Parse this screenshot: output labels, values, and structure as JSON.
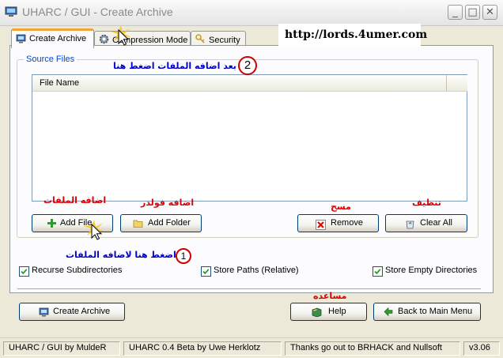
{
  "window": {
    "title": "UHARC / GUI - Create Archive",
    "controls": {
      "minimize": "_",
      "maximize": "□",
      "close": "✕"
    }
  },
  "tabs": [
    {
      "label": "Create Archive",
      "active": true,
      "icon": "create-archive-icon"
    },
    {
      "label": "Compression Mode",
      "active": false,
      "icon": "gear-icon"
    },
    {
      "label": "Security",
      "active": false,
      "icon": "keys-icon"
    }
  ],
  "watermark_url": "http://lords.4umer.com",
  "source_files": {
    "label": "Source Files",
    "column_header": "File Name",
    "items": []
  },
  "buttons": {
    "add_file": "Add File",
    "add_folder": "Add Folder",
    "remove": "Remove",
    "clear_all": "Clear All",
    "create_archive": "Create Archive",
    "help": "Help",
    "back": "Back to Main Menu"
  },
  "options": [
    {
      "label": "Recurse Subdirectories",
      "checked": true
    },
    {
      "label": "Store Paths (Relative)",
      "checked": true
    },
    {
      "label": "Store Empty Directories",
      "checked": true
    }
  ],
  "annotations": {
    "step1_number": "1",
    "step1_text": "اضغط هنا لاضافه الملفات",
    "step2_number": "2",
    "step2_text": "بعد اضافه الملفات اضغط هنا",
    "add_files": "اضافه الملفات",
    "add_folder": "اضافه فولدر",
    "remove": "مسح",
    "clear": "تنظيف",
    "help": "مساعده"
  },
  "statusbar": {
    "author": "UHARC / GUI by MuldeR",
    "engine": "UHARC 0.4 Beta by Uwe Herklotz",
    "thanks": "Thanks go out to BRHACK and Nullsoft",
    "version": "v3.06"
  },
  "colors": {
    "window_bg": "#ece9d8",
    "tab_accent": "#f0a43a",
    "group_label": "#0046d5",
    "annotation_red": "#e00000",
    "annotation_blue": "#0000cc"
  }
}
